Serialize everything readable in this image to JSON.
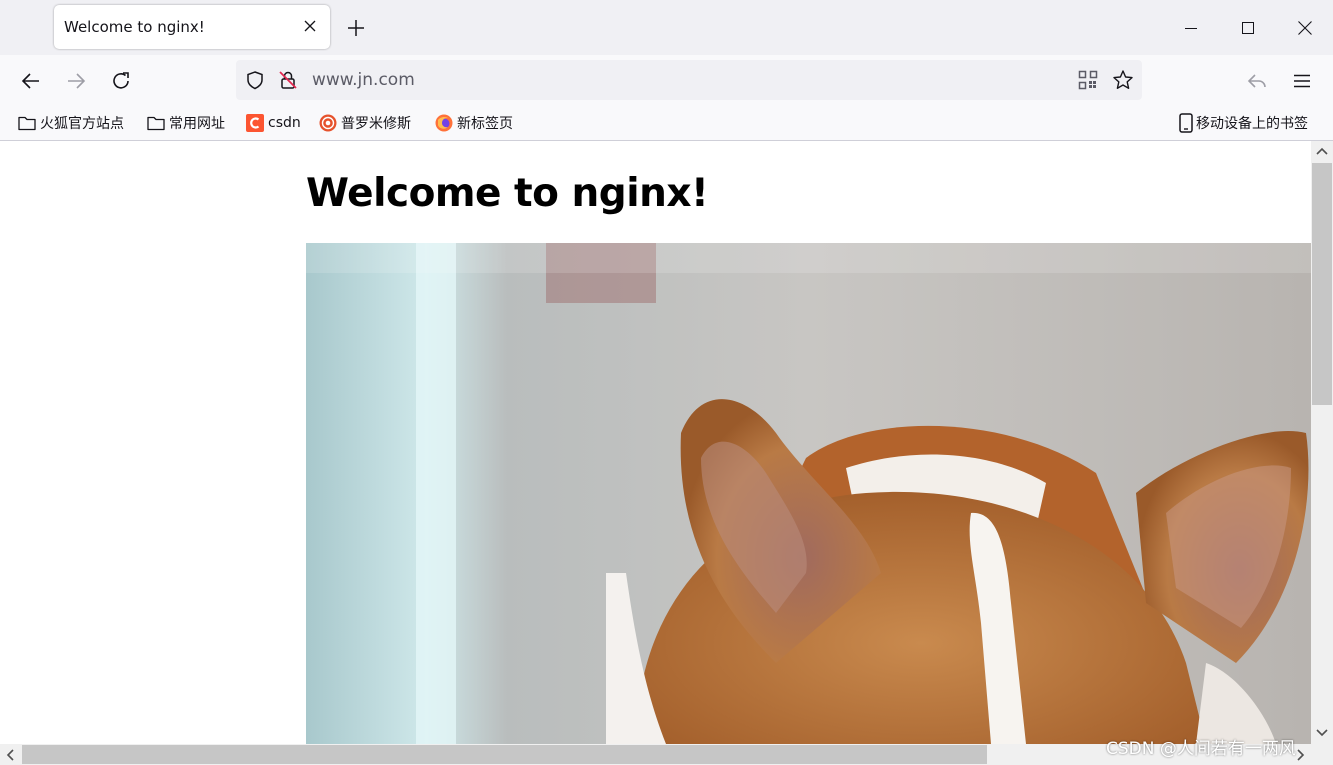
{
  "window": {
    "minimize_icon": "minimize-icon",
    "maximize_icon": "maximize-icon",
    "close_icon": "close-icon"
  },
  "tab": {
    "title": "Welcome to nginx!"
  },
  "toolbar": {
    "url": "www.jn.com",
    "icons": [
      "back-icon",
      "forward-icon",
      "reload-icon",
      "shield-icon",
      "insecure-lock-icon",
      "qr-code-icon",
      "bookmark-star-icon",
      "share-icon",
      "menu-icon"
    ]
  },
  "bookmarks": {
    "items": [
      {
        "label": "火狐官方站点",
        "icon": "folder-icon"
      },
      {
        "label": "常用网址",
        "icon": "folder-icon"
      },
      {
        "label": "csdn",
        "icon": "csdn-icon"
      },
      {
        "label": "普罗米修斯",
        "icon": "prometheus-icon"
      },
      {
        "label": "新标签页",
        "icon": "firefox-icon"
      }
    ],
    "mobile": {
      "label": "移动设备上的书签",
      "icon": "mobile-icon"
    }
  },
  "page": {
    "heading": "Welcome to nginx!"
  },
  "watermark": "CSDN @人间若有一两风",
  "colors": {
    "titlebar": "#f0f0f4",
    "toolbar": "#f9f9fb",
    "urlbar": "#f0f0f4",
    "csdn": "#fc5531"
  }
}
